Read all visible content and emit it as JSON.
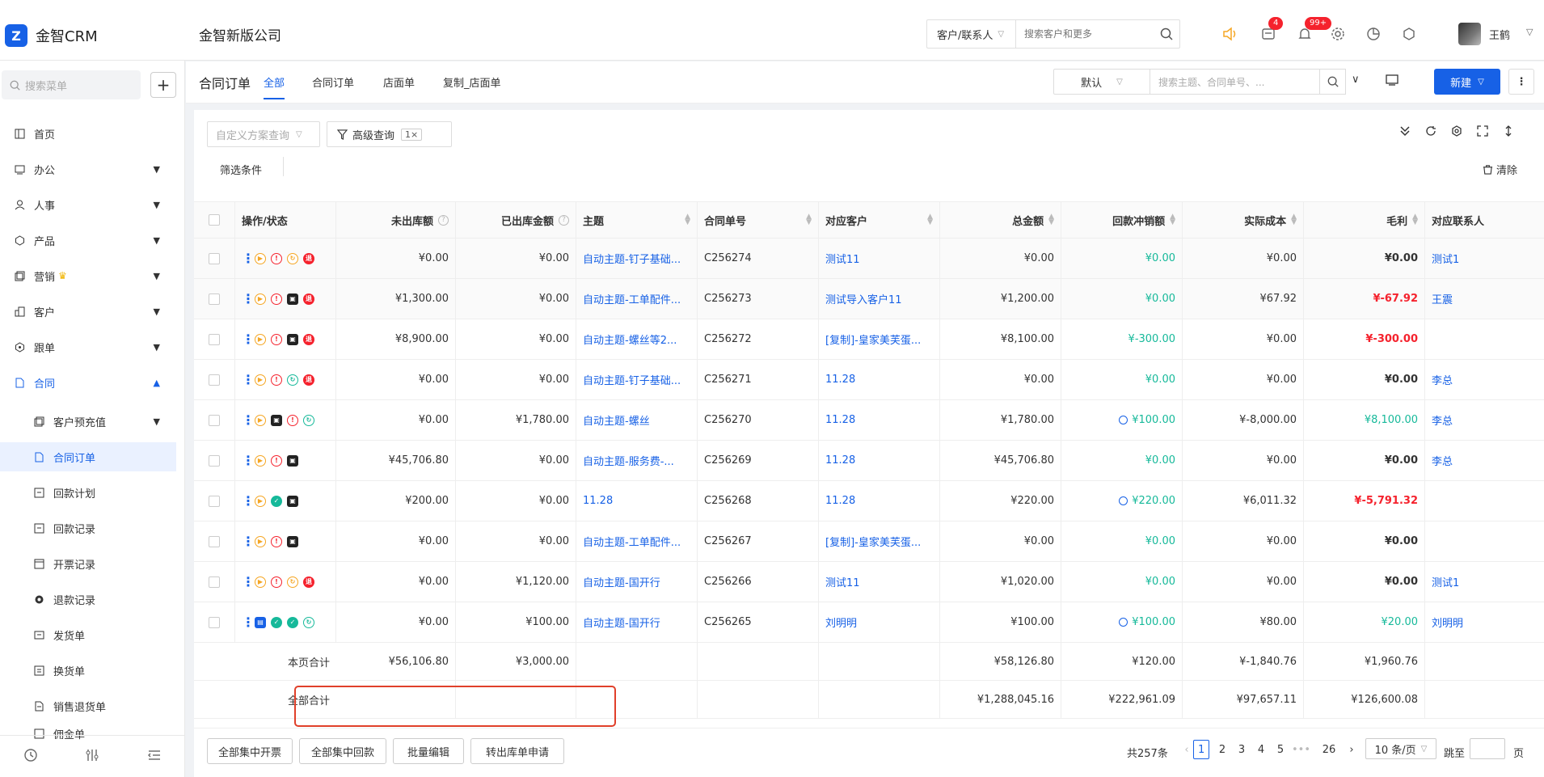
{
  "app": {
    "logo_text": "金智CRM",
    "company": "金智新版公司"
  },
  "header": {
    "search_type": "客户/联系人",
    "search_placeholder": "搜索客户和更多",
    "badge_messages": "4",
    "badge_notifications": "99+",
    "user_name": "王鹤"
  },
  "sidebar": {
    "search_placeholder": "搜索菜单",
    "items": [
      {
        "label": "首页",
        "icon": "layout-icon"
      },
      {
        "label": "办公",
        "icon": "office-icon"
      },
      {
        "label": "人事",
        "icon": "people-icon"
      },
      {
        "label": "产品",
        "icon": "cube-icon"
      },
      {
        "label": "营销",
        "icon": "marketing-icon"
      },
      {
        "label": "客户",
        "icon": "customer-icon"
      },
      {
        "label": "跟单",
        "icon": "follow-icon"
      },
      {
        "label": "合同",
        "icon": "contract-icon"
      }
    ],
    "sub_items": [
      {
        "label": "客户预充值"
      },
      {
        "label": "合同订单"
      },
      {
        "label": "回款计划"
      },
      {
        "label": "回款记录"
      },
      {
        "label": "开票记录"
      },
      {
        "label": "退款记录"
      },
      {
        "label": "发货单"
      },
      {
        "label": "换货单"
      },
      {
        "label": "销售退货单"
      },
      {
        "label": "佣金单"
      }
    ]
  },
  "subheader": {
    "title": "合同订单",
    "tabs": [
      "全部",
      "合同订单",
      "店面单",
      "复制_店面单"
    ],
    "view_select": "默认",
    "list_search_placeholder": "搜索主题、合同单号、...",
    "new_button": "新建"
  },
  "toolbar": {
    "scheme_placeholder": "自定义方案查询",
    "advanced_query": "高级查询",
    "advanced_count": "1×",
    "filter_label": "筛选条件",
    "clear_label": "清除"
  },
  "table": {
    "headers": [
      "操作/状态",
      "未出库额",
      "已出库金额",
      "主题",
      "合同单号",
      "对应客户",
      "总金额",
      "回款冲销额",
      "实际成本",
      "毛利",
      "对应联系人"
    ],
    "rows": [
      {
        "unshipped": "¥0.00",
        "shipped": "¥0.00",
        "subject": "自动主题-钉子基础...",
        "no": "C256274",
        "customer": "测试11",
        "total": "¥0.00",
        "writeoff": "¥0.00",
        "cost": "¥0.00",
        "profit": "¥0.00",
        "contact": "测试1"
      },
      {
        "unshipped": "¥1,300.00",
        "shipped": "¥0.00",
        "subject": "自动主题-工单配件...",
        "no": "C256273",
        "customer": "测试导入客户11",
        "total": "¥1,200.00",
        "writeoff": "¥0.00",
        "cost": "¥67.92",
        "profit": "¥-67.92",
        "contact": "王震"
      },
      {
        "unshipped": "¥8,900.00",
        "shipped": "¥0.00",
        "subject": "自动主题-螺丝等2...",
        "no": "C256272",
        "customer": "[复制]-皇家美芙蛋...",
        "total": "¥8,100.00",
        "writeoff": "¥-300.00",
        "cost": "¥0.00",
        "profit": "¥-300.00",
        "contact": ""
      },
      {
        "unshipped": "¥0.00",
        "shipped": "¥0.00",
        "subject": "自动主题-钉子基础...",
        "no": "C256271",
        "customer": "11.28",
        "total": "¥0.00",
        "writeoff": "¥0.00",
        "cost": "¥0.00",
        "profit": "¥0.00",
        "contact": "李总"
      },
      {
        "unshipped": "¥0.00",
        "shipped": "¥1,780.00",
        "subject": "自动主题-螺丝",
        "no": "C256270",
        "customer": "11.28",
        "total": "¥1,780.00",
        "writeoff": "¥100.00",
        "cost": "¥-8,000.00",
        "profit": "¥8,100.00",
        "contact": "李总"
      },
      {
        "unshipped": "¥45,706.80",
        "shipped": "¥0.00",
        "subject": "自动主题-服务费-...",
        "no": "C256269",
        "customer": "11.28",
        "total": "¥45,706.80",
        "writeoff": "¥0.00",
        "cost": "¥0.00",
        "profit": "¥0.00",
        "contact": "李总"
      },
      {
        "unshipped": "¥200.00",
        "shipped": "¥0.00",
        "subject": "11.28",
        "no": "C256268",
        "customer": "11.28",
        "total": "¥220.00",
        "writeoff": "¥220.00",
        "cost": "¥6,011.32",
        "profit": "¥-5,791.32",
        "contact": ""
      },
      {
        "unshipped": "¥0.00",
        "shipped": "¥0.00",
        "subject": "自动主题-工单配件...",
        "no": "C256267",
        "customer": "[复制]-皇家美芙蛋...",
        "total": "¥0.00",
        "writeoff": "¥0.00",
        "cost": "¥0.00",
        "profit": "¥0.00",
        "contact": ""
      },
      {
        "unshipped": "¥0.00",
        "shipped": "¥1,120.00",
        "subject": "自动主题-国开行",
        "no": "C256266",
        "customer": "测试11",
        "total": "¥1,020.00",
        "writeoff": "¥0.00",
        "cost": "¥0.00",
        "profit": "¥0.00",
        "contact": "测试1"
      },
      {
        "unshipped": "¥0.00",
        "shipped": "¥100.00",
        "subject": "自动主题-国开行",
        "no": "C256265",
        "customer": "刘明明",
        "total": "¥100.00",
        "writeoff": "¥100.00",
        "cost": "¥80.00",
        "profit": "¥20.00",
        "contact": "刘明明"
      }
    ],
    "page_total": {
      "label": "本页合计",
      "unshipped": "¥56,106.80",
      "shipped": "¥3,000.00",
      "total": "¥58,126.80",
      "writeoff": "¥120.00",
      "cost": "¥-1,840.76",
      "profit": "¥1,960.76"
    },
    "all_total": {
      "label": "全部合计",
      "total": "¥1,288,045.16",
      "writeoff": "¥222,961.09",
      "cost": "¥97,657.11",
      "profit": "¥126,600.08"
    }
  },
  "footer": {
    "buttons": [
      "全部集中开票",
      "全部集中回款",
      "批量编辑",
      "转出库单申请"
    ],
    "total_count": "共257条",
    "pages": [
      "1",
      "2",
      "3",
      "4",
      "5",
      "•••",
      "26"
    ],
    "page_size": "10 条/页",
    "jump_label": "跳至",
    "page_unit": "页"
  }
}
